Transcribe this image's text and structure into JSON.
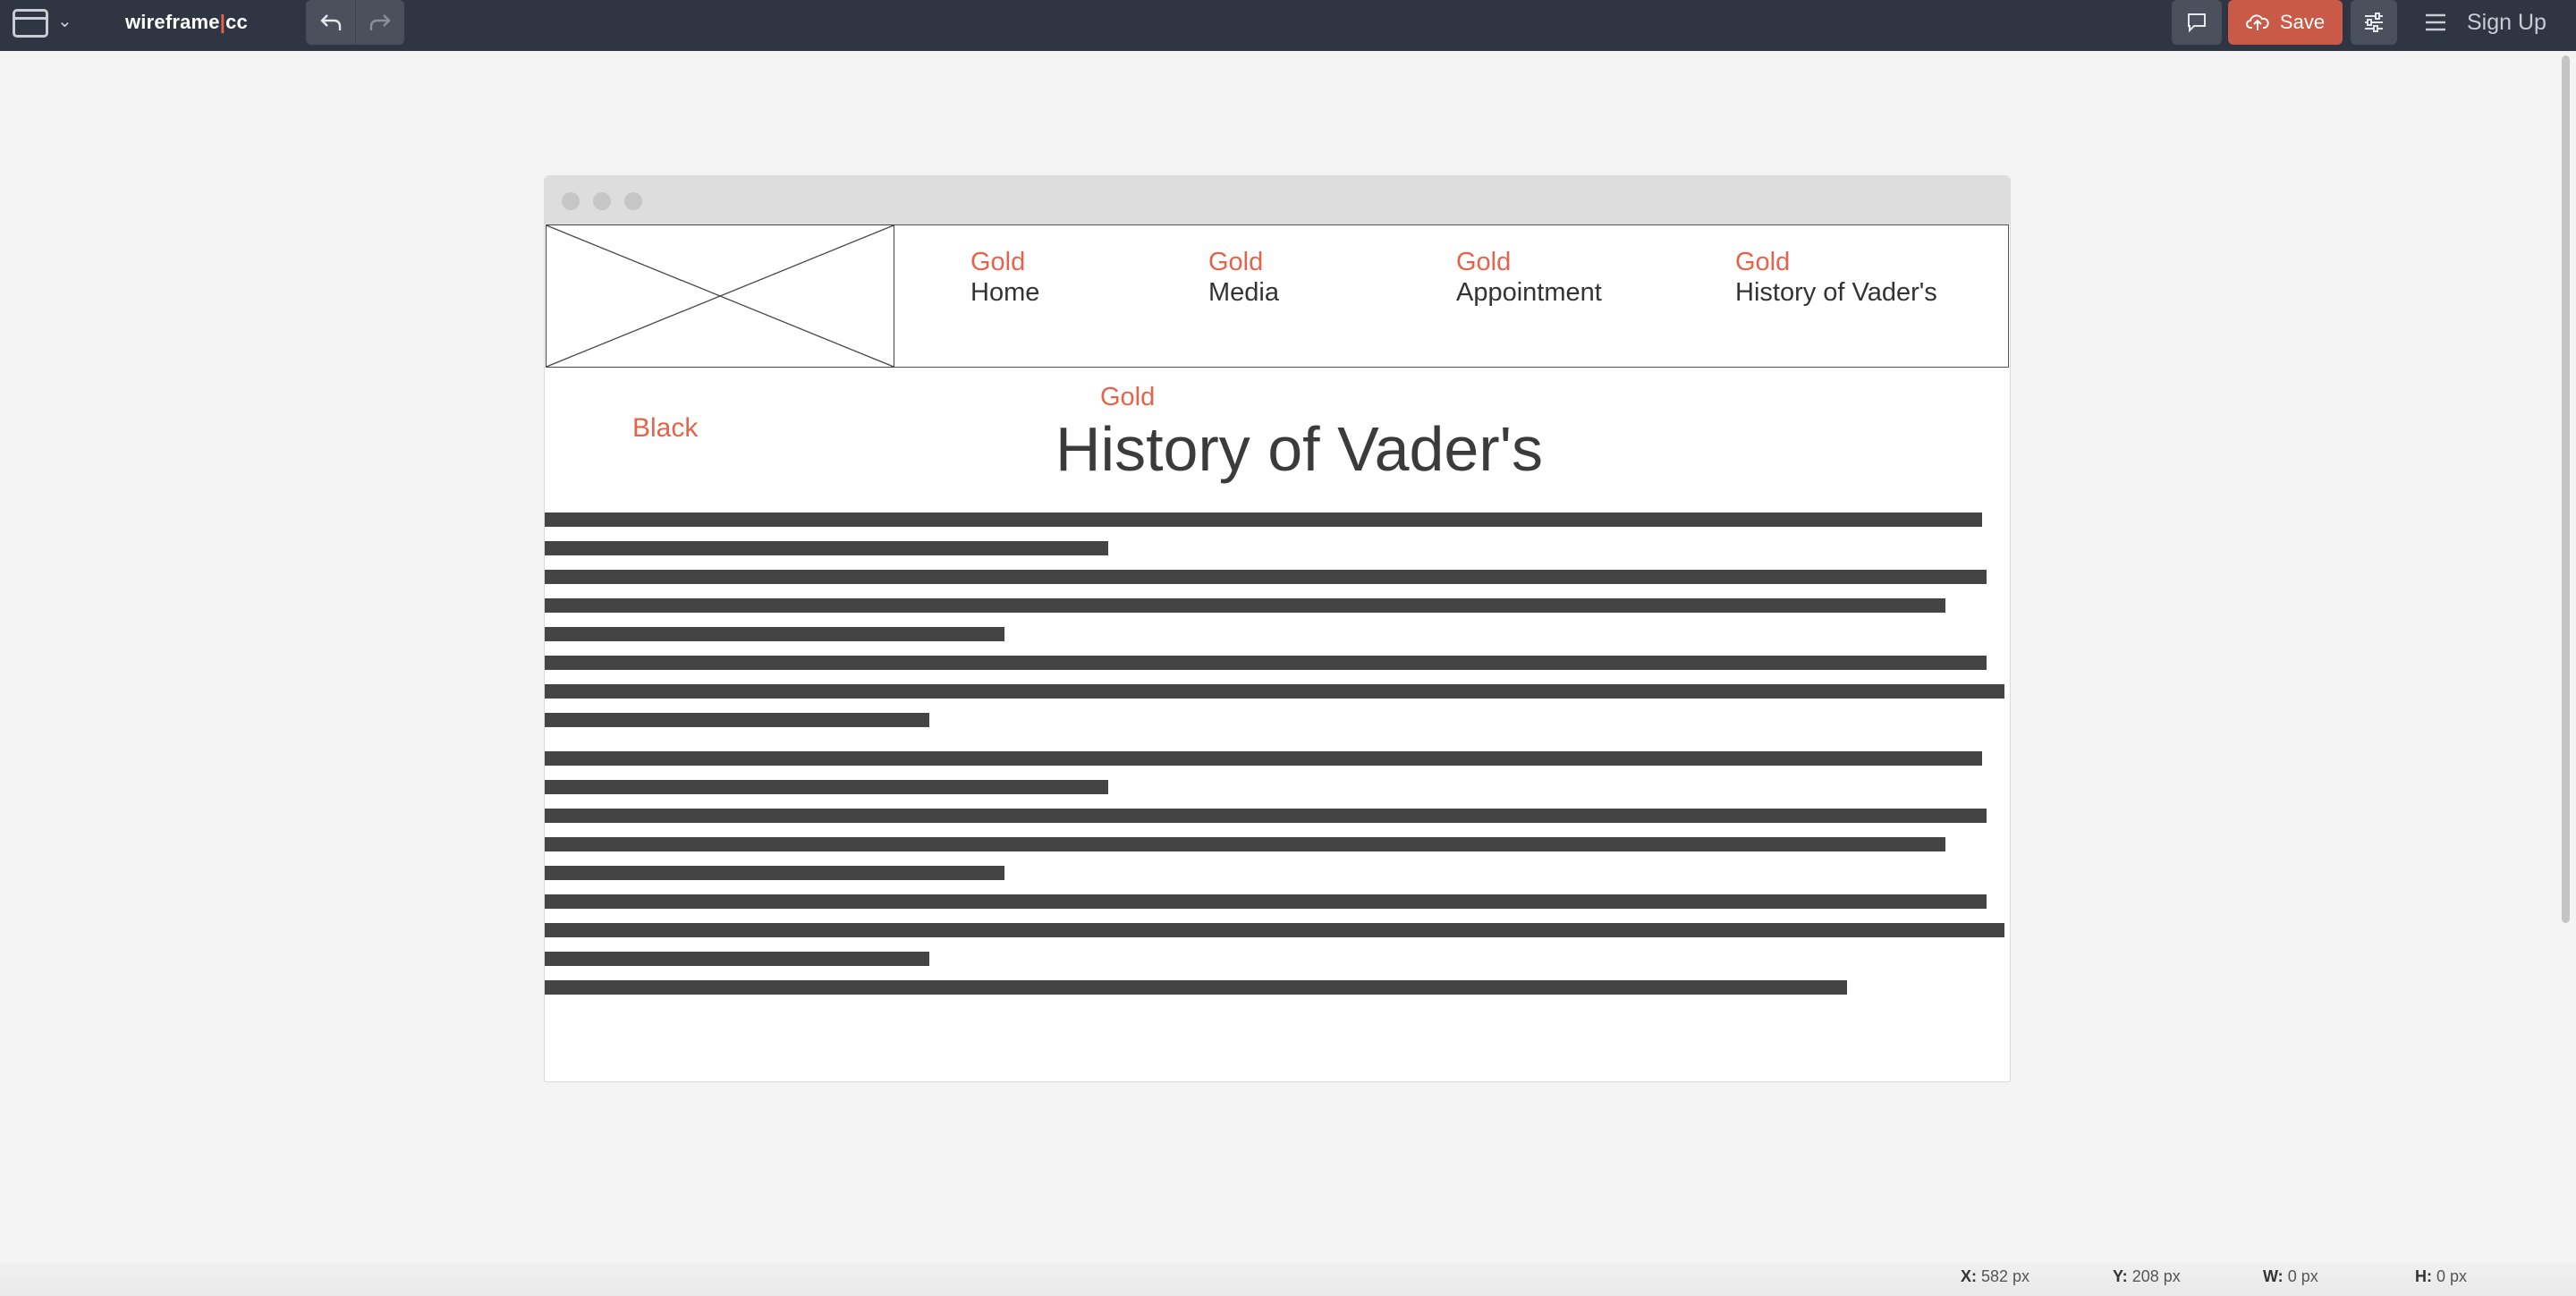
{
  "app": {
    "logo": {
      "prefix": "wireframe",
      "separator": "|",
      "suffix": "cc"
    }
  },
  "toolbar": {
    "window_menu_icon": "window-icon",
    "undo_icon": "undo-icon",
    "redo_icon": "redo-icon",
    "comment_icon": "comment-icon",
    "save_label": "Save",
    "settings_icon": "sliders-icon",
    "menu_icon": "hamburger-icon",
    "signup_label": "Sign Up"
  },
  "colors": {
    "topbar": "#2f3542",
    "accent": "#e5634a",
    "save_button": "#c95a48"
  },
  "wireframe": {
    "nav": [
      {
        "annotation": "Gold",
        "label": "Home"
      },
      {
        "annotation": "Gold",
        "label": "Media"
      },
      {
        "annotation": "Gold",
        "label": "Appointment"
      },
      {
        "annotation": "Gold",
        "label": "History of Vader's"
      }
    ],
    "side_annotation": "Black",
    "title_annotation": "Gold",
    "title": "History of Vader's"
  },
  "status": {
    "x_label": "X:",
    "x_value": "582 px",
    "y_label": "Y:",
    "y_value": "208 px",
    "w_label": "W:",
    "w_value": "0 px",
    "h_label": "H:",
    "h_value": "0 px"
  }
}
